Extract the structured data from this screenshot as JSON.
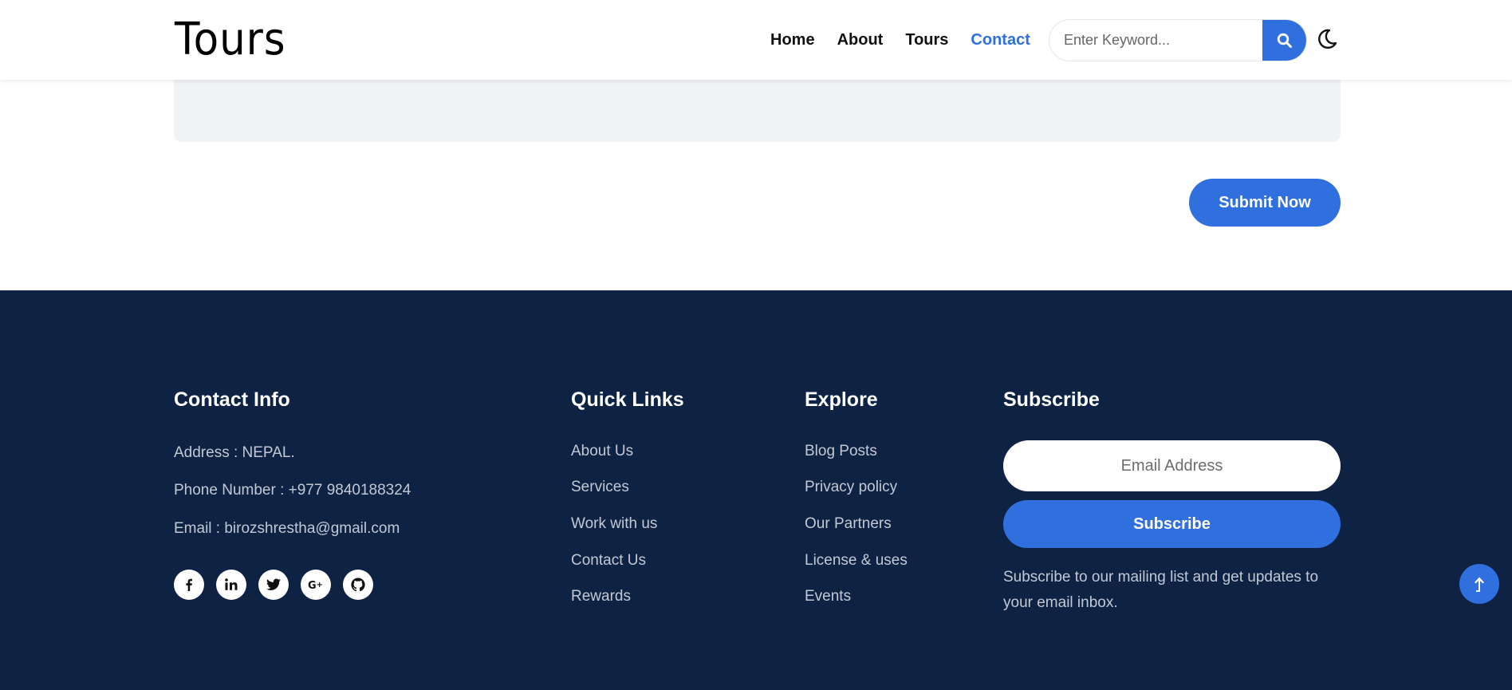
{
  "header": {
    "logo": "Tours",
    "nav": [
      {
        "label": "Home"
      },
      {
        "label": "About"
      },
      {
        "label": "Tours"
      },
      {
        "label": "Contact",
        "active": true
      }
    ],
    "search": {
      "placeholder": "Enter Keyword...",
      "value": "",
      "icon": "search-icon"
    },
    "theme_toggle_icon": "moon-icon"
  },
  "form": {
    "submit_label": "Submit Now"
  },
  "footer": {
    "contact": {
      "title": "Contact Info",
      "address": "Address : NEPAL.",
      "phone": "Phone Number : +977 9840188324",
      "email": "Email : birozshrestha@gmail.com",
      "socials": [
        "facebook-icon",
        "linkedin-icon",
        "twitter-icon",
        "google-plus-icon",
        "github-icon"
      ]
    },
    "quick_links": {
      "title": "Quick Links",
      "items": [
        "About Us",
        "Services",
        "Work with us",
        "Contact Us",
        "Rewards"
      ]
    },
    "explore": {
      "title": "Explore",
      "items": [
        "Blog Posts",
        "Privacy policy",
        "Our Partners",
        "License & uses",
        "Events"
      ]
    },
    "subscribe": {
      "title": "Subscribe",
      "email_placeholder": "Email Address",
      "button_label": "Subscribe",
      "text": "Subscribe to our mailing list and get updates to your email inbox."
    }
  },
  "colors": {
    "accent": "#2f6fde",
    "footer_bg": "#0e2244",
    "footer_text": "#c3c9d4"
  },
  "scroll_top_icon": "arrow-up-icon"
}
